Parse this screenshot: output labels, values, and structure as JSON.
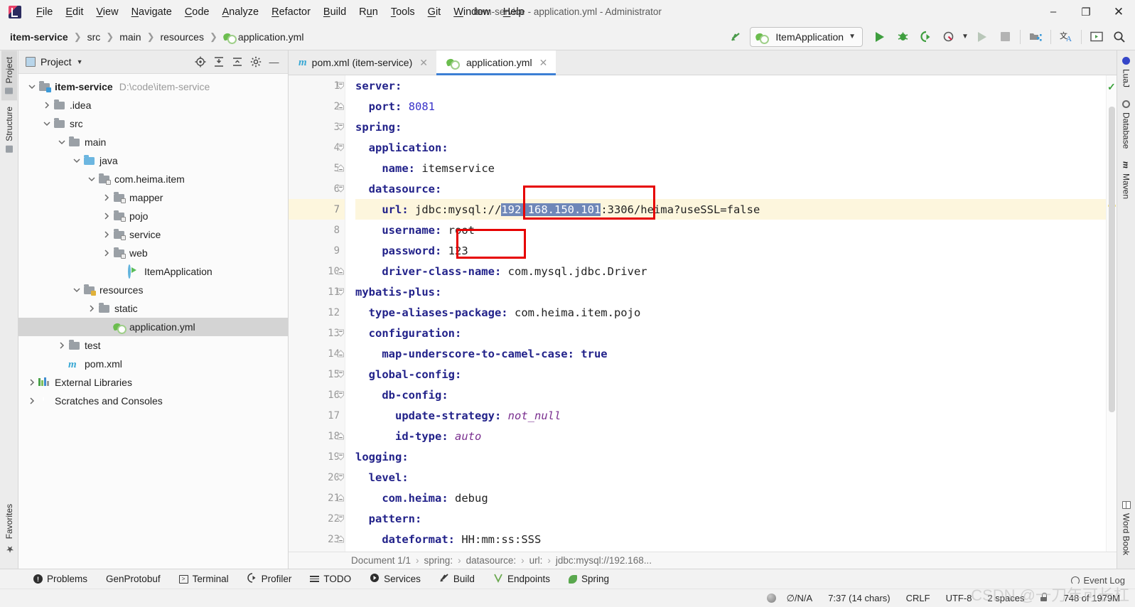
{
  "window": {
    "title": "item-service - application.yml - Administrator",
    "minimize_label": "–",
    "maximize_label": "❐",
    "close_label": "✕"
  },
  "menu": {
    "items": [
      {
        "label": "File",
        "mnemonic": "F"
      },
      {
        "label": "Edit",
        "mnemonic": "E"
      },
      {
        "label": "View",
        "mnemonic": "V"
      },
      {
        "label": "Navigate",
        "mnemonic": "N"
      },
      {
        "label": "Code",
        "mnemonic": "C"
      },
      {
        "label": "Analyze",
        "mnemonic": "A"
      },
      {
        "label": "Refactor",
        "mnemonic": "R"
      },
      {
        "label": "Build",
        "mnemonic": "B"
      },
      {
        "label": "Run",
        "mnemonic": "u"
      },
      {
        "label": "Tools",
        "mnemonic": "T"
      },
      {
        "label": "Git",
        "mnemonic": "G"
      },
      {
        "label": "Window",
        "mnemonic": "W"
      },
      {
        "label": "Help",
        "mnemonic": "H"
      }
    ]
  },
  "navbar": {
    "crumbs": [
      "item-service",
      "src",
      "main",
      "resources",
      "application.yml"
    ],
    "run_config": "ItemApplication",
    "icons": [
      "update-project-icon",
      "run-icon",
      "debug-icon",
      "run-with-coverage-icon",
      "profiler-icon",
      "rerun-icon",
      "stop-icon",
      "project-structure-icon",
      "translate-icon",
      "terminal-icon",
      "search-everywhere-icon"
    ]
  },
  "left_rail": {
    "top": [
      {
        "label": "Project",
        "icon": "project-folder-icon",
        "active": true
      },
      {
        "label": "Structure",
        "icon": "structure-icon",
        "active": false
      }
    ],
    "bottom": [
      {
        "label": "Favorites",
        "icon": "star-icon",
        "active": false
      }
    ]
  },
  "right_rail": {
    "top": [
      {
        "label": "LuaJ",
        "icon": "luaj-icon"
      },
      {
        "label": "Database",
        "icon": "database-icon"
      },
      {
        "label": "Maven",
        "icon": "maven-icon"
      }
    ],
    "bottom": [
      {
        "label": "Word Book",
        "icon": "word-book-icon"
      }
    ]
  },
  "project_panel": {
    "title": "Project",
    "header_icons": [
      "locate-icon",
      "expand-all-icon",
      "collapse-all-icon",
      "settings-gear-icon",
      "hide-icon"
    ],
    "tree": [
      {
        "label": "item-service",
        "path": "D:\\code\\item-service",
        "depth": 0,
        "arrow": "down",
        "icon": "module-folder",
        "bold": true,
        "selected": false
      },
      {
        "label": ".idea",
        "path": "",
        "depth": 1,
        "arrow": "right",
        "icon": "folder",
        "bold": false,
        "selected": false
      },
      {
        "label": "src",
        "path": "",
        "depth": 1,
        "arrow": "down",
        "icon": "folder",
        "bold": false,
        "selected": false
      },
      {
        "label": "main",
        "path": "",
        "depth": 2,
        "arrow": "down",
        "icon": "folder",
        "bold": false,
        "selected": false
      },
      {
        "label": "java",
        "path": "",
        "depth": 3,
        "arrow": "down",
        "icon": "source-folder",
        "bold": false,
        "selected": false
      },
      {
        "label": "com.heima.item",
        "path": "",
        "depth": 4,
        "arrow": "down",
        "icon": "package",
        "bold": false,
        "selected": false
      },
      {
        "label": "mapper",
        "path": "",
        "depth": 5,
        "arrow": "right",
        "icon": "package",
        "bold": false,
        "selected": false
      },
      {
        "label": "pojo",
        "path": "",
        "depth": 5,
        "arrow": "right",
        "icon": "package",
        "bold": false,
        "selected": false
      },
      {
        "label": "service",
        "path": "",
        "depth": 5,
        "arrow": "right",
        "icon": "package",
        "bold": false,
        "selected": false
      },
      {
        "label": "web",
        "path": "",
        "depth": 5,
        "arrow": "right",
        "icon": "package",
        "bold": false,
        "selected": false
      },
      {
        "label": "ItemApplication",
        "path": "",
        "depth": 6,
        "arrow": "",
        "icon": "spring-class",
        "bold": false,
        "selected": false
      },
      {
        "label": "resources",
        "path": "",
        "depth": 3,
        "arrow": "down",
        "icon": "resource-folder",
        "bold": false,
        "selected": false
      },
      {
        "label": "static",
        "path": "",
        "depth": 4,
        "arrow": "right",
        "icon": "folder",
        "bold": false,
        "selected": false
      },
      {
        "label": "application.yml",
        "path": "",
        "depth": 5,
        "arrow": "",
        "icon": "yaml-file",
        "bold": false,
        "selected": true
      },
      {
        "label": "test",
        "path": "",
        "depth": 2,
        "arrow": "right",
        "icon": "folder",
        "bold": false,
        "selected": false
      },
      {
        "label": "pom.xml",
        "path": "",
        "depth": 2,
        "arrow": "",
        "icon": "maven-file",
        "bold": false,
        "selected": false
      },
      {
        "label": "External Libraries",
        "path": "",
        "depth": 0,
        "arrow": "right",
        "icon": "libraries",
        "bold": false,
        "selected": false
      },
      {
        "label": "Scratches and Consoles",
        "path": "",
        "depth": 0,
        "arrow": "right",
        "icon": "scratches",
        "bold": false,
        "selected": false
      }
    ]
  },
  "editor": {
    "tabs": [
      {
        "label": "pom.xml (item-service)",
        "icon": "maven-file",
        "active": false,
        "close": "✕"
      },
      {
        "label": "application.yml",
        "icon": "yaml-file",
        "active": true,
        "close": "✕"
      }
    ],
    "current_line": 7,
    "lines": [
      {
        "n": 1,
        "indent": 0,
        "key": "server",
        "colon": ":",
        "value": "",
        "vtype": "",
        "fold": "minus"
      },
      {
        "n": 2,
        "indent": 1,
        "key": "port",
        "colon": ":",
        "value": "8081",
        "vtype": "num",
        "fold": "dot"
      },
      {
        "n": 3,
        "indent": 0,
        "key": "spring",
        "colon": ":",
        "value": "",
        "vtype": "",
        "fold": "minus"
      },
      {
        "n": 4,
        "indent": 1,
        "key": "application",
        "colon": ":",
        "value": "",
        "vtype": "",
        "fold": "minus"
      },
      {
        "n": 5,
        "indent": 2,
        "key": "name",
        "colon": ":",
        "value": "itemservice",
        "vtype": "plain",
        "fold": "dot"
      },
      {
        "n": 6,
        "indent": 1,
        "key": "datasource",
        "colon": ":",
        "value": "",
        "vtype": "",
        "fold": "minus"
      },
      {
        "n": 7,
        "indent": 2,
        "key": "url",
        "colon": ":",
        "value": "jdbc:mysql://192.168.150.101:3306/heima?useSSL=false",
        "vtype": "url",
        "fold": "",
        "selection": "192.168.150.101",
        "bold_key": false
      },
      {
        "n": 8,
        "indent": 2,
        "key": "username",
        "colon": ":",
        "value": "root",
        "vtype": "plain",
        "fold": ""
      },
      {
        "n": 9,
        "indent": 2,
        "key": "password",
        "colon": ":",
        "value": "123",
        "vtype": "plain",
        "fold": ""
      },
      {
        "n": 10,
        "indent": 2,
        "key": "driver-class-name",
        "colon": ":",
        "value": "com.mysql.jdbc.Driver",
        "vtype": "plain",
        "fold": "dot"
      },
      {
        "n": 11,
        "indent": 0,
        "key": "mybatis-plus",
        "colon": ":",
        "value": "",
        "vtype": "",
        "fold": "minus"
      },
      {
        "n": 12,
        "indent": 1,
        "key": "type-aliases-package",
        "colon": ":",
        "value": "com.heima.item.pojo",
        "vtype": "plain",
        "fold": ""
      },
      {
        "n": 13,
        "indent": 1,
        "key": "configuration",
        "colon": ":",
        "value": "",
        "vtype": "",
        "fold": "minus"
      },
      {
        "n": 14,
        "indent": 2,
        "key": "map-underscore-to-camel-case",
        "colon": ":",
        "value": "true",
        "vtype": "bold",
        "fold": "dot"
      },
      {
        "n": 15,
        "indent": 1,
        "key": "global-config",
        "colon": ":",
        "value": "",
        "vtype": "",
        "fold": "minus"
      },
      {
        "n": 16,
        "indent": 2,
        "key": "db-config",
        "colon": ":",
        "value": "",
        "vtype": "",
        "fold": "minus"
      },
      {
        "n": 17,
        "indent": 3,
        "key": "update-strategy",
        "colon": ":",
        "value": "not_null",
        "vtype": "ital",
        "fold": ""
      },
      {
        "n": 18,
        "indent": 3,
        "key": "id-type",
        "colon": ":",
        "value": "auto",
        "vtype": "ital",
        "fold": "dot"
      },
      {
        "n": 19,
        "indent": 0,
        "key": "logging",
        "colon": ":",
        "value": "",
        "vtype": "",
        "fold": "minus"
      },
      {
        "n": 20,
        "indent": 1,
        "key": "level",
        "colon": ":",
        "value": "",
        "vtype": "",
        "fold": "minus"
      },
      {
        "n": 21,
        "indent": 2,
        "key": "com.heima",
        "colon": ":",
        "value": "debug",
        "vtype": "plain",
        "fold": "dot"
      },
      {
        "n": 22,
        "indent": 1,
        "key": "pattern",
        "colon": ":",
        "value": "",
        "vtype": "",
        "fold": "minus"
      },
      {
        "n": 23,
        "indent": 2,
        "key": "dateformat",
        "colon": ":",
        "value": "HH:mm:ss:SSS",
        "vtype": "plain",
        "fold": "dot"
      }
    ],
    "breadcrumb": [
      "Document 1/1",
      "spring:",
      "datasource:",
      "url:",
      "jdbc:mysql://192.168..."
    ],
    "inspection_status": "ok-check",
    "annotations": [
      {
        "name": "url-host-highlight",
        "color": "#e60000"
      },
      {
        "name": "password-value-highlight",
        "color": "#e60000"
      }
    ]
  },
  "bottom_tools": [
    {
      "label": "Problems",
      "icon": "problems-icon"
    },
    {
      "label": "GenProtobuf",
      "icon": "genprotobuf-icon"
    },
    {
      "label": "Terminal",
      "icon": "terminal-icon"
    },
    {
      "label": "Profiler",
      "icon": "profiler-icon"
    },
    {
      "label": "TODO",
      "icon": "todo-icon"
    },
    {
      "label": "Services",
      "icon": "services-icon"
    },
    {
      "label": "Build",
      "icon": "build-icon"
    },
    {
      "label": "Endpoints",
      "icon": "endpoints-icon"
    },
    {
      "label": "Spring",
      "icon": "spring-icon"
    }
  ],
  "statusbar": {
    "git_branch": "∅/N/A",
    "caret": "7:37 (14 chars)",
    "line_separator": "CRLF",
    "encoding": "UTF-8",
    "indent": "2 spaces",
    "lock_icon": "read-only-lock-icon",
    "memory": "748 of 1979M",
    "event_log": "Event Log",
    "watermark": "CSDN @一刀年可长杠"
  }
}
